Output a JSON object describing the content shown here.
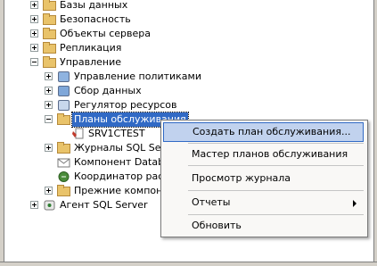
{
  "tree": {
    "items": [
      {
        "label": "Базы данных"
      },
      {
        "label": "Безопасность"
      },
      {
        "label": "Объекты сервера"
      },
      {
        "label": "Репликация"
      },
      {
        "label": "Управление"
      },
      {
        "label": "Управление политиками"
      },
      {
        "label": "Сбор данных"
      },
      {
        "label": "Регулятор ресурсов"
      },
      {
        "label": "Планы обслуживания"
      },
      {
        "label": "SRV1CTEST"
      },
      {
        "label": "Журналы SQL Serv"
      },
      {
        "label": "Компонент Databa"
      },
      {
        "label": "Координатор расп"
      },
      {
        "label": "Прежние компонен"
      },
      {
        "label": "Агент SQL Server"
      }
    ]
  },
  "context_menu": {
    "items": [
      {
        "label": "Создать план обслуживания..."
      },
      {
        "label": "Мастер планов обслуживания"
      },
      {
        "label": "Просмотр журнала"
      },
      {
        "label": "Отчеты"
      },
      {
        "label": "Обновить"
      }
    ]
  },
  "colors": {
    "selection": "#316ac5",
    "menu_highlight": "#c1d2ee",
    "folder": "#e9c36a"
  }
}
